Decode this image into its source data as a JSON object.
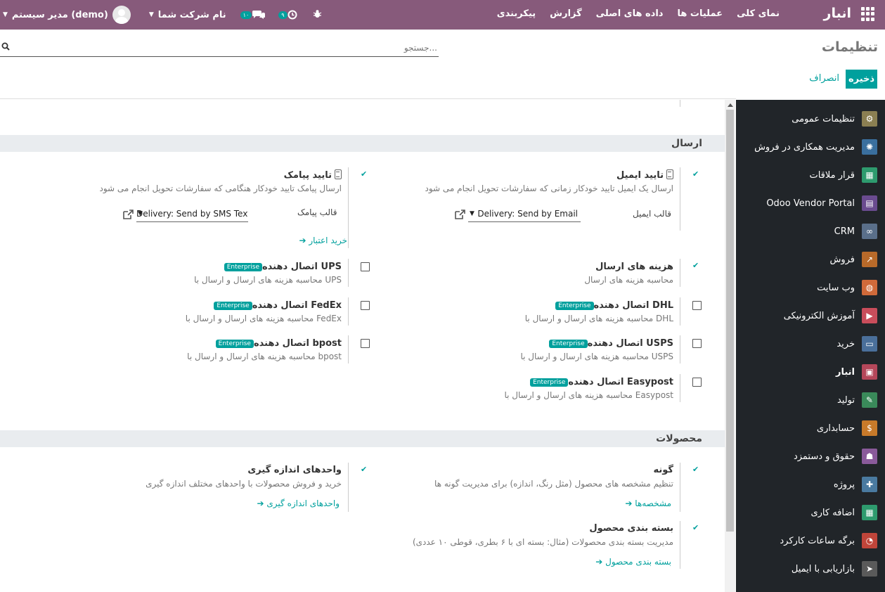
{
  "navbar": {
    "brand": "انبار",
    "menu": [
      "نمای کلی",
      "عملیات ها",
      "داده های اصلی",
      "گزارش",
      "پیکربندی"
    ],
    "user": "مدیر سیستم (demo)",
    "company": "نام شرکت شما",
    "chat_count": "۱۰",
    "activity_count": "۹"
  },
  "control_panel": {
    "breadcrumb": "تنظیمات",
    "search_placeholder": "جستجو...",
    "save": "ذخیره",
    "discard": "انصراف"
  },
  "sidebar": {
    "items": [
      {
        "label": "تنظیمات عمومی",
        "icon": "gear-icon",
        "color": "#8b7f52"
      },
      {
        "label": "مدیریت همکاری در فروش",
        "icon": "partner-icon",
        "color": "#3a6f9e"
      },
      {
        "label": "قرار ملاقات",
        "icon": "calendar-icon",
        "color": "#2e9b6e"
      },
      {
        "label": "Odoo Vendor Portal",
        "icon": "portal-icon",
        "color": "#6a4b8f"
      },
      {
        "label": "CRM",
        "icon": "handshake-icon",
        "color": "#5a6f8a"
      },
      {
        "label": "فروش",
        "icon": "chart-icon",
        "color": "#b86a2a"
      },
      {
        "label": "وب سایت",
        "icon": "globe-icon",
        "color": "#d06a3a"
      },
      {
        "label": "آموزش الکترونیکی",
        "icon": "elearning-icon",
        "color": "#c94d5b"
      },
      {
        "label": "خرید",
        "icon": "purchase-icon",
        "color": "#4a6f9a"
      },
      {
        "label": "انبار",
        "icon": "box-icon",
        "color": "#b5475a"
      },
      {
        "label": "تولید",
        "icon": "wrench-icon",
        "color": "#3a8a5a"
      },
      {
        "label": "حسابداری",
        "icon": "invoice-icon",
        "color": "#c87a2a"
      },
      {
        "label": "حقوق و دستمزد",
        "icon": "payroll-icon",
        "color": "#8a5a9a"
      },
      {
        "label": "پروژه",
        "icon": "puzzle-icon",
        "color": "#4a7aa0"
      },
      {
        "label": "اضافه کاری",
        "icon": "overtime-icon",
        "color": "#2e9b6e"
      },
      {
        "label": "برگه ساعات کارکرد",
        "icon": "stopwatch-icon",
        "color": "#c0453a"
      },
      {
        "label": "بازاریابی با ایمیل",
        "icon": "paper-plane-icon",
        "color": "#5a5a5a"
      }
    ]
  },
  "sections": {
    "shipping": "ارسال",
    "products": "محصولات"
  },
  "shipping": {
    "email_title": "تایید ایمیل",
    "email_desc": "ارسال یک ایمیل تایید خودکار زمانی که سفارشات تحویل انجام می شود",
    "email_template_label": "قالب ایمیل",
    "email_template_value": "Delivery: Send by Email",
    "sms_title": "تایید پیامک",
    "sms_desc": "ارسال پیامک تایید خودکار هنگامی که سفارشات تحویل انجام می شود",
    "sms_template_label": "قالب پیامک",
    "sms_template_value": "Delivery: Send by SMS Text Message",
    "buy_credits": "خرید اعتبار",
    "shipping_costs_title": "هزینه های ارسال",
    "shipping_costs_desc": "محاسبه هزینه های ارسال",
    "ups_title": "اتصال دهنده UPS",
    "ups_desc": "محاسبه هزینه های ارسال و ارسال با UPS",
    "dhl_title": "اتصال دهنده DHL",
    "dhl_desc": "محاسبه هزینه های ارسال و ارسال با DHL",
    "fedex_title": "اتصال دهنده FedEx",
    "fedex_desc": "محاسبه هزینه های ارسال و ارسال با FedEx",
    "usps_title": "اتصال دهنده USPS",
    "usps_desc": "محاسبه هزینه های ارسال و ارسال با USPS",
    "bpost_title": "اتصال دهنده bpost",
    "bpost_desc": "محاسبه هزینه های ارسال و ارسال با bpost",
    "easypost_title": "اتصال دهنده Easypost",
    "easypost_desc": "محاسبه هزینه های ارسال و ارسال با Easypost",
    "enterprise": "Enterprise"
  },
  "products": {
    "variants_title": "گونه",
    "variants_desc": "تنظیم مشخصه های محصول (مثل رنگ، اندازه) برای مدیریت گونه ها",
    "variants_link": "مشخصه‌ها",
    "uom_title": "واحدهای اندازه گیری",
    "uom_desc": "خرید و فروش محصولات با واحدهای مختلف اندازه گیری",
    "uom_link": "واحدهای اندازه گیری",
    "packaging_title": "بسته بندی محصول",
    "packaging_desc": "مدیریت بسته بندی محصولات (مثال: بسته ای با ۶ بطری، قوطی ۱۰ عددی)",
    "packaging_link": "بسته بندی محصول"
  }
}
